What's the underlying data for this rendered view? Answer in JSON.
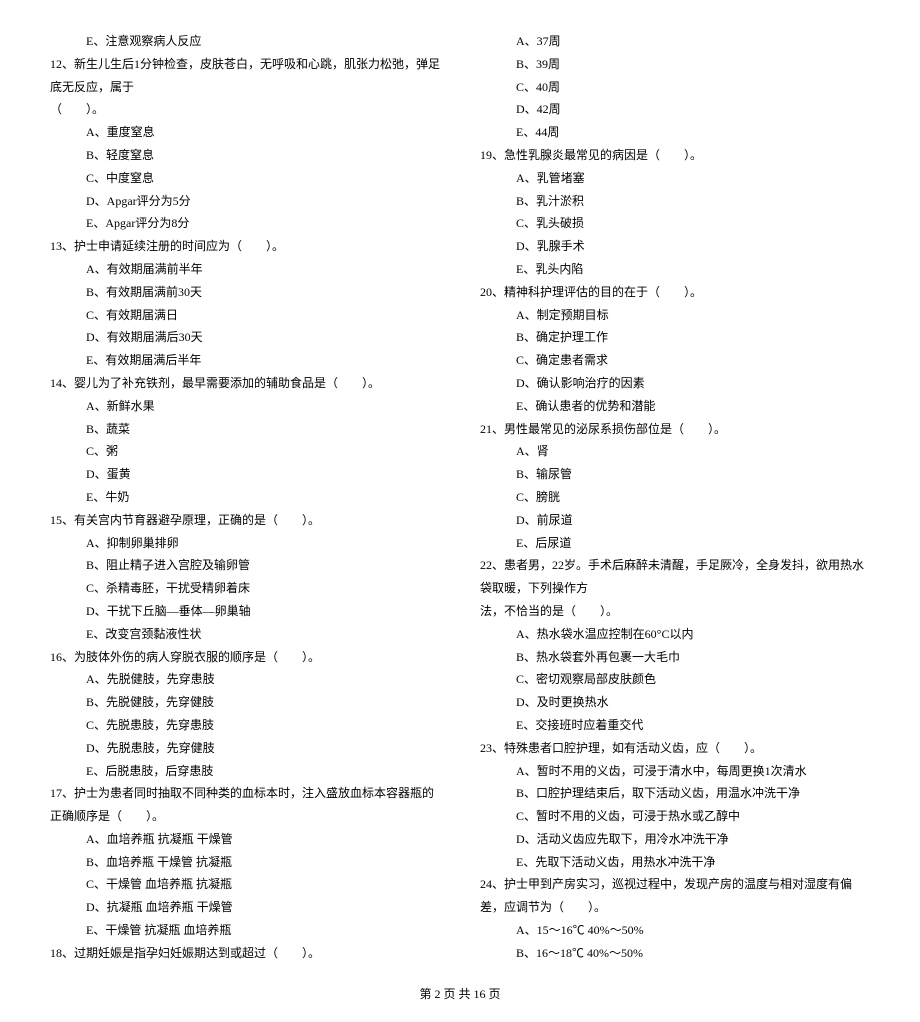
{
  "footer": "第 2 页 共 16 页",
  "left": {
    "e11": "E、注意观察病人反应",
    "q12_stem1": "12、新生儿生后1分钟检查，皮肤苍白，无呼吸和心跳，肌张力松弛，弹足底无反应，属于",
    "q12_stem2": "（　　）。",
    "q12a": "A、重度窒息",
    "q12b": "B、轻度窒息",
    "q12c": "C、中度窒息",
    "q12d": "D、Apgar评分为5分",
    "q12e": "E、Apgar评分为8分",
    "q13_stem": "13、护士申请延续注册的时间应为（　　）。",
    "q13a": "A、有效期届满前半年",
    "q13b": "B、有效期届满前30天",
    "q13c": "C、有效期届满日",
    "q13d": "D、有效期届满后30天",
    "q13e": "E、有效期届满后半年",
    "q14_stem": "14、婴儿为了补充铁剂，最早需要添加的辅助食品是（　　）。",
    "q14a": "A、新鲜水果",
    "q14b": "B、蔬菜",
    "q14c": "C、粥",
    "q14d": "D、蛋黄",
    "q14e": "E、牛奶",
    "q15_stem": "15、有关宫内节育器避孕原理，正确的是（　　）。",
    "q15a": "A、抑制卵巢排卵",
    "q15b": "B、阻止精子进入宫腔及输卵管",
    "q15c": "C、杀精毒胚，干扰受精卵着床",
    "q15d": "D、干扰下丘脑—垂体—卵巢轴",
    "q15e": "E、改变宫颈黏液性状",
    "q16_stem": "16、为肢体外伤的病人穿脱衣服的顺序是（　　）。",
    "q16a": "A、先脱健肢，先穿患肢",
    "q16b": "B、先脱健肢，先穿健肢",
    "q16c": "C、先脱患肢，先穿患肢",
    "q16d": "D、先脱患肢，先穿健肢",
    "q16e": "E、后脱患肢，后穿患肢",
    "q17_stem": "17、护士为患者同时抽取不同种类的血标本时，注入盛放血标本容器瓶的正确顺序是（　　）。",
    "q17a": "A、血培养瓶 抗凝瓶 干燥管",
    "q17b": "B、血培养瓶 干燥管 抗凝瓶",
    "q17c": "C、干燥管 血培养瓶 抗凝瓶",
    "q17d": "D、抗凝瓶 血培养瓶 干燥管",
    "q17e": "E、干燥管 抗凝瓶 血培养瓶",
    "q18_stem": "18、过期妊娠是指孕妇妊娠期达到或超过（　　）。"
  },
  "right": {
    "q18a": "A、37周",
    "q18b": "B、39周",
    "q18c": "C、40周",
    "q18d": "D、42周",
    "q18e": "E、44周",
    "q19_stem": "19、急性乳腺炎最常见的病因是（　　）。",
    "q19a": "A、乳管堵塞",
    "q19b": "B、乳汁淤积",
    "q19c": "C、乳头破损",
    "q19d": "D、乳腺手术",
    "q19e": "E、乳头内陷",
    "q20_stem": "20、精神科护理评估的目的在于（　　）。",
    "q20a": "A、制定预期目标",
    "q20b": "B、确定护理工作",
    "q20c": "C、确定患者需求",
    "q20d": "D、确认影响治疗的因素",
    "q20e": "E、确认患者的优势和潜能",
    "q21_stem": "21、男性最常见的泌尿系损伤部位是（　　）。",
    "q21a": "A、肾",
    "q21b": "B、输尿管",
    "q21c": "C、膀胱",
    "q21d": "D、前尿道",
    "q21e": "E、后尿道",
    "q22_stem1": "22、患者男，22岁。手术后麻醉未清醒，手足厥冷，全身发抖，欲用热水袋取暖，下列操作方",
    "q22_stem2": "法，不恰当的是（　　）。",
    "q22a": "A、热水袋水温应控制在60°C以内",
    "q22b": "B、热水袋套外再包裹一大毛巾",
    "q22c": "C、密切观察局部皮肤颜色",
    "q22d": "D、及时更换热水",
    "q22e": "E、交接班时应着重交代",
    "q23_stem": "23、特殊患者口腔护理，如有活动义齿，应（　　）。",
    "q23a": "A、暂时不用的义齿，可浸于清水中，每周更换1次清水",
    "q23b": "B、口腔护理结束后，取下活动义齿，用温水冲洗干净",
    "q23c": "C、暂时不用的义齿，可浸于热水或乙醇中",
    "q23d": "D、活动义齿应先取下，用冷水冲洗干净",
    "q23e": "E、先取下活动义齿，用热水冲洗干净",
    "q24_stem": "24、护士甲到产房实习，巡视过程中，发现产房的温度与相对湿度有偏差，应调节为（　　）。",
    "q24a": "A、15～16℃ 40%～50%",
    "q24b": "B、16～18℃ 40%～50%"
  }
}
